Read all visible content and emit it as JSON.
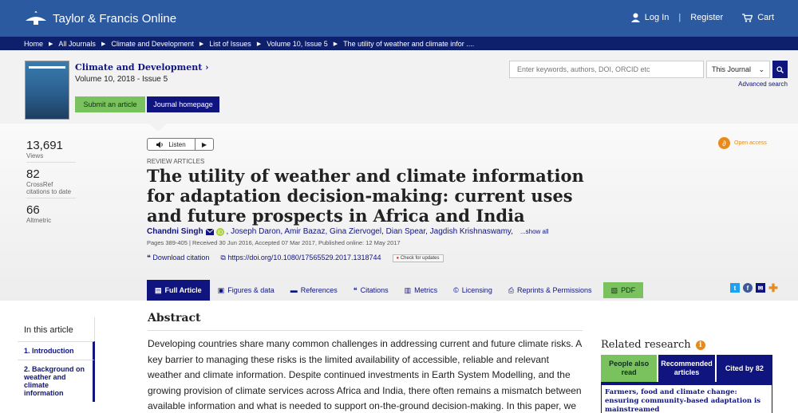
{
  "brand": {
    "name": "Taylor & Francis Online"
  },
  "header": {
    "login": "Log In",
    "register": "Register",
    "cart": "Cart"
  },
  "breadcrumb": [
    "Home",
    "All Journals",
    "Climate and Development",
    "List of Issues",
    "Volume 10, Issue 5",
    "The utility of weather and climate infor ...."
  ],
  "journal": {
    "title": "Climate and Development",
    "chevron": "›",
    "volume": "Volume 10, 2018 - Issue 5",
    "submit": "Submit an article",
    "homepage": "Journal homepage"
  },
  "search": {
    "placeholder": "Enter keywords, authors, DOI, ORCID etc",
    "scope": "This Journal",
    "advanced": "Advanced search"
  },
  "stats": [
    {
      "value": "13,691",
      "label": "Views"
    },
    {
      "value": "82",
      "label": "CrossRef citations to date"
    },
    {
      "value": "66",
      "label": "Altmetric"
    }
  ],
  "listen": {
    "label": "Listen"
  },
  "open_access": "Open access",
  "article": {
    "type": "REVIEW ARTICLES",
    "title": "The utility of weather and climate information for adaptation decision-making: current uses and future prospects in Africa and India",
    "first_author": "Chandni Singh",
    "other_authors": ", Joseph Daron, Amir Bazaz, Gina Ziervogel, Dian Spear, Jagdish Krishnaswamy,",
    "show_all": "...show all",
    "meta": "Pages 389-405 | Received 30 Jun 2016, Accepted 07 Mar 2017, Published online: 12 May 2017",
    "download_citation": "Download citation",
    "doi": "https://doi.org/10.1080/17565529.2017.1318744",
    "check_updates": "Check for updates"
  },
  "tabs": [
    "Full Article",
    "Figures & data",
    "References",
    "Citations",
    "Metrics",
    "Licensing",
    "Reprints & Permissions",
    "PDF"
  ],
  "sidebar": {
    "title": "In this article",
    "items": [
      "1. Introduction",
      "2. Background on weather and climate information"
    ]
  },
  "abstract": {
    "heading": "Abstract",
    "text": "Developing countries share many common challenges in addressing current and future climate risks. A key barrier to managing these risks is the limited availability of accessible, reliable and relevant weather and climate information. Despite continued investments in Earth System Modelling, and the growing provision of climate services across Africa and India, there often remains a mismatch between available information and what is needed to support on-the-ground decision-making. In this paper, we outline the range of"
  },
  "related": {
    "title": "Related research",
    "tabs": [
      "People also read",
      "Recommended articles",
      "Cited by 82"
    ],
    "first_item": "Farmers, food and climate change: ensuring community-based adaptation is mainstreamed"
  },
  "colors": {
    "navy": "#10147e",
    "topbar": "#2c5aa0",
    "green": "#79c25d",
    "orange": "#e98b1b"
  }
}
